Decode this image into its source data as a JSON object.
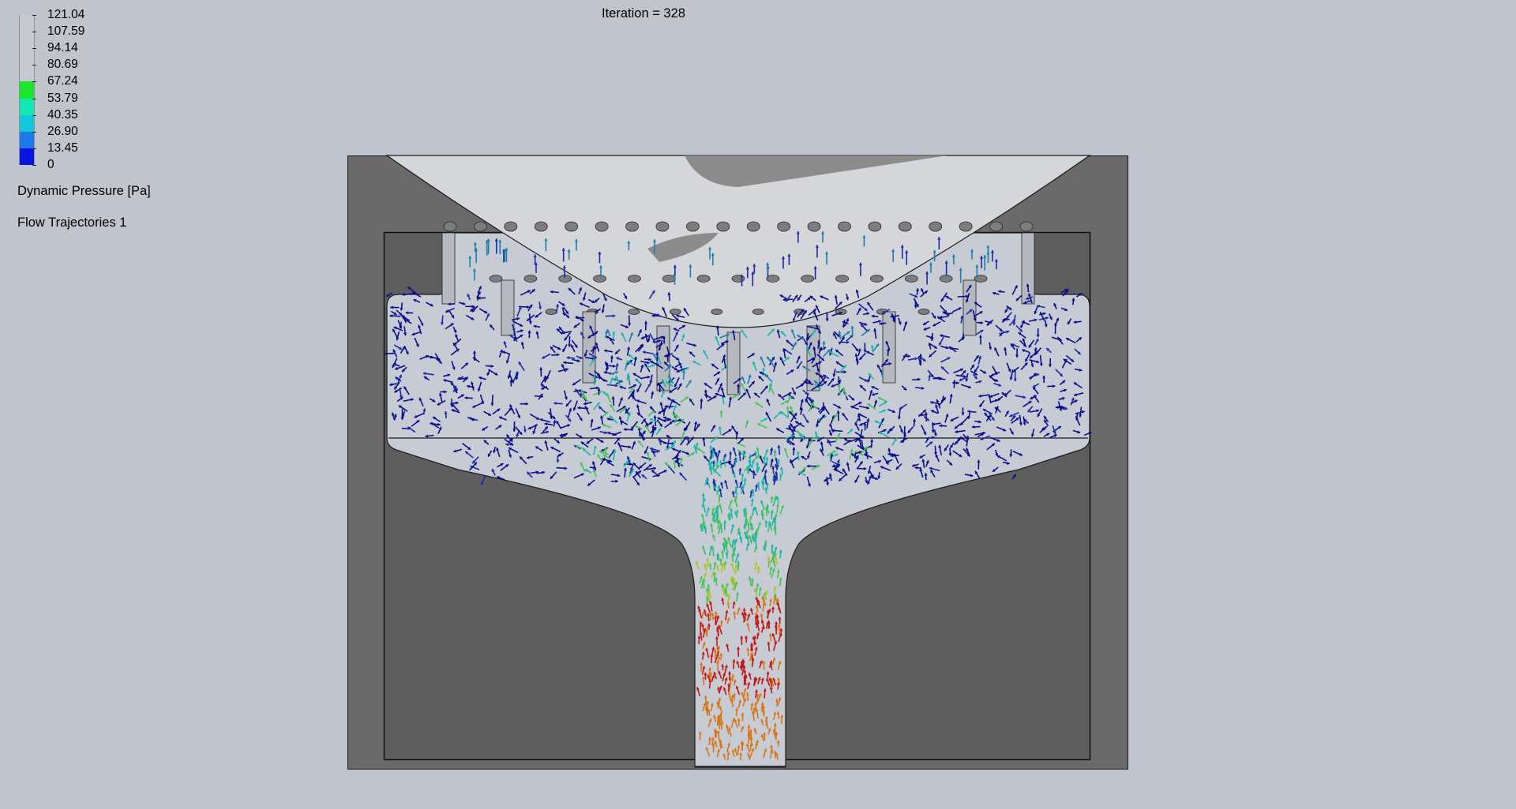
{
  "legend": {
    "tick_labels": [
      "121.04",
      "107.59",
      "94.14",
      "80.69",
      "67.24",
      "53.79",
      "40.35",
      "26.90",
      "13.45",
      "0"
    ],
    "colorbar_segments": [
      {
        "from": "121.04",
        "to": "67.24",
        "color": "#c6c9cf"
      },
      {
        "from": "67.24",
        "to": "53.79",
        "color": "#19e62d"
      },
      {
        "from": "53.79",
        "to": "40.35",
        "color": "#12e8b2"
      },
      {
        "from": "40.35",
        "to": "26.90",
        "color": "#14c6d9"
      },
      {
        "from": "26.90",
        "to": "13.45",
        "color": "#1d78e8"
      },
      {
        "from": "13.45",
        "to": "0",
        "color": "#0a14e0"
      }
    ],
    "quantity_label": "Dynamic Pressure [Pa]",
    "trajectory_label": "Flow Trajectories 1"
  },
  "header": {
    "iteration_text": "Iteration = 328"
  },
  "scene": {
    "colors": {
      "outer_body": "#6a6a6a",
      "inner_body": "#5e5e5e",
      "flow_region": "#c7cbd4",
      "dome": "#d4d6da",
      "dome_shadow": "#8c8c8c",
      "outline": "#1a1a1a"
    },
    "arrow_colors": [
      "#0b0f8a",
      "#1a2aa5",
      "#1f7fa8",
      "#19b7a8",
      "#44c25a",
      "#b3c418",
      "#d8761a",
      "#c21818"
    ]
  }
}
